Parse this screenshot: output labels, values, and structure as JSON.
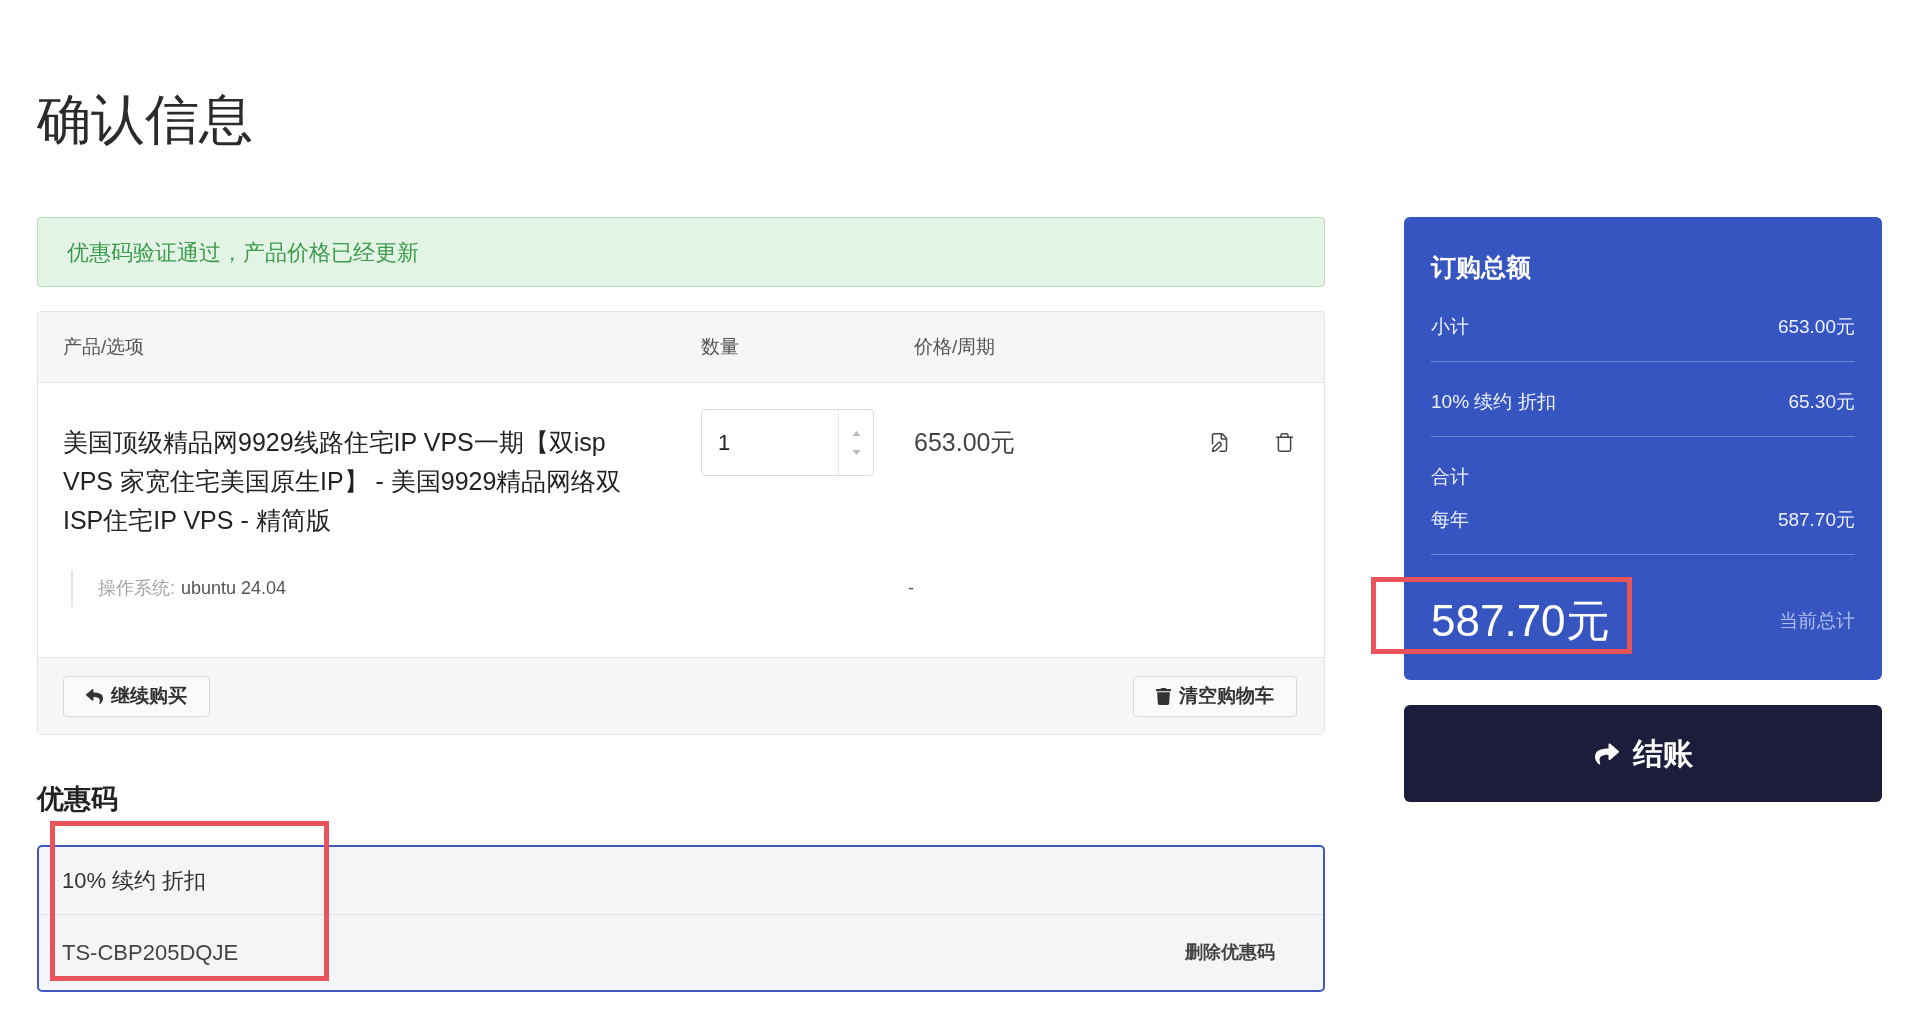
{
  "page": {
    "title": "确认信息"
  },
  "alert": {
    "kind": "success",
    "text": "优惠码验证通过，产品价格已经更新"
  },
  "cart": {
    "columns": [
      "产品/选项",
      "数量",
      "价格/周期"
    ],
    "items": [
      {
        "name": "美国顶级精品网9929线路住宅IP VPS一期【双isp VPS 家宽住宅美国原生IP】 - 美国9929精品网络双ISP住宅IP VPS - 精简版",
        "quantity": "1",
        "price": "653.00元",
        "options": [
          {
            "label": "操作系统:",
            "value": "ubuntu 24.04",
            "price": "-"
          }
        ]
      }
    ],
    "buttons": [
      {
        "kind": "continue",
        "label": "继续购买"
      },
      {
        "kind": "empty",
        "label": "清空购物车"
      }
    ]
  },
  "coupon": {
    "heading": "优惠码",
    "name": "10% 续约 折扣",
    "code": "TS-CBP205DQJE",
    "remove": "删除优惠码",
    "highlighted": true
  },
  "summary": {
    "title": "订购总额",
    "lines": [
      {
        "kind": "line",
        "label": "小计",
        "value": "653.00元"
      },
      {
        "kind": "line",
        "label": "10% 续约 折扣",
        "value": "65.30元"
      },
      {
        "kind": "recurring",
        "label": "合计",
        "period": "每年",
        "value": "587.70元"
      }
    ],
    "total": "587.70元",
    "total_label": "当前总计",
    "highlighted": true
  },
  "checkout": {
    "label": "结账"
  }
}
